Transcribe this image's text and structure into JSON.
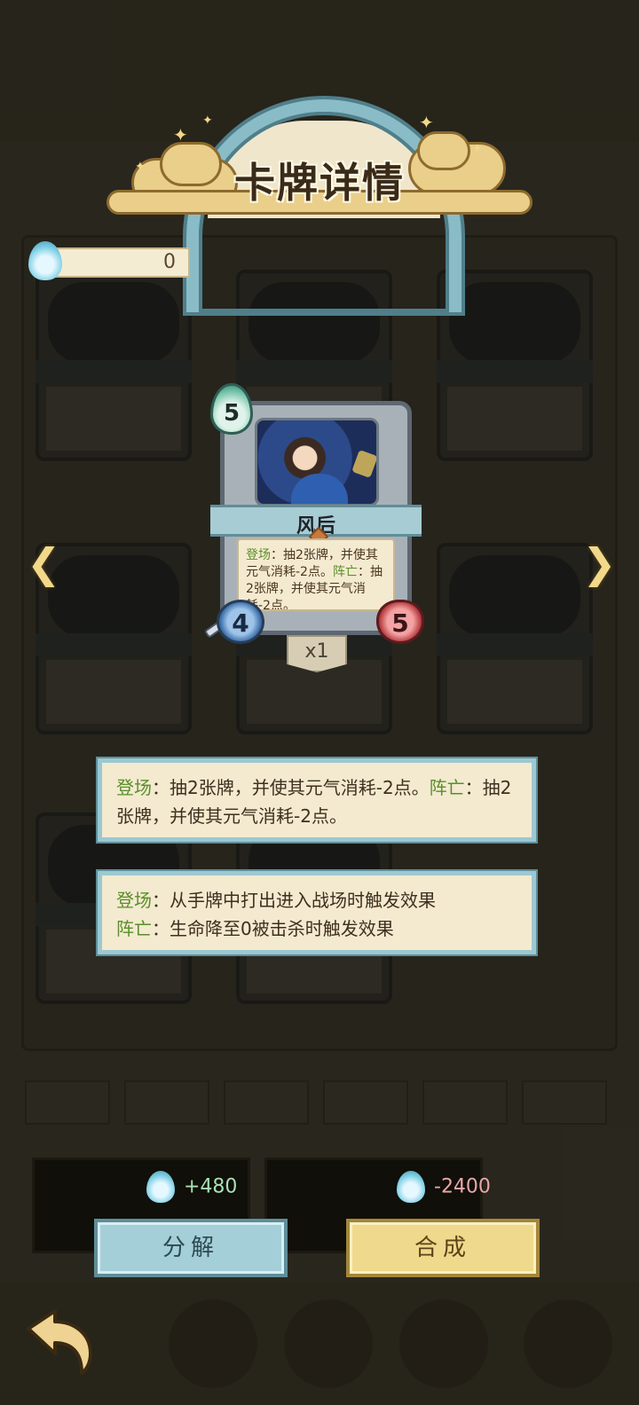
{
  "overlay": {
    "title": "卡牌详情",
    "currency_value": "0"
  },
  "card": {
    "name": "风后",
    "cost": "5",
    "attack": "4",
    "health": "5",
    "count": "x1",
    "text_kw1": "登场",
    "text_1": "：抽2张牌，并使其元气消耗-2点。",
    "text_kw2": "阵亡",
    "text_2": "：抽2张牌，并使其元气消耗-2点。"
  },
  "effect_box": {
    "kw1": "登场",
    "text1": "：抽2张牌，并使其元气消耗-2点。",
    "kw2": "阵亡",
    "text2": "：抽2张牌，并使其元气消耗-2点。"
  },
  "glossary_box": {
    "kw1": "登场",
    "text1": "：从手牌中打出进入战场时触发效果",
    "kw2": "阵亡",
    "text2": "：生命降至0被击杀时触发效果"
  },
  "actions": {
    "decompose_gain": "+480",
    "compose_cost": "-2400",
    "decompose_label": "分解",
    "compose_label": "合成"
  },
  "icons": {
    "currency": "spirit-flame-icon",
    "back": "back-arrow-icon",
    "prev": "chevron-left-icon",
    "next": "chevron-right-icon"
  },
  "colors": {
    "accent_blue": "#89bcc7",
    "gold": "#efd98c",
    "keyword_green": "#5a8e2a"
  }
}
